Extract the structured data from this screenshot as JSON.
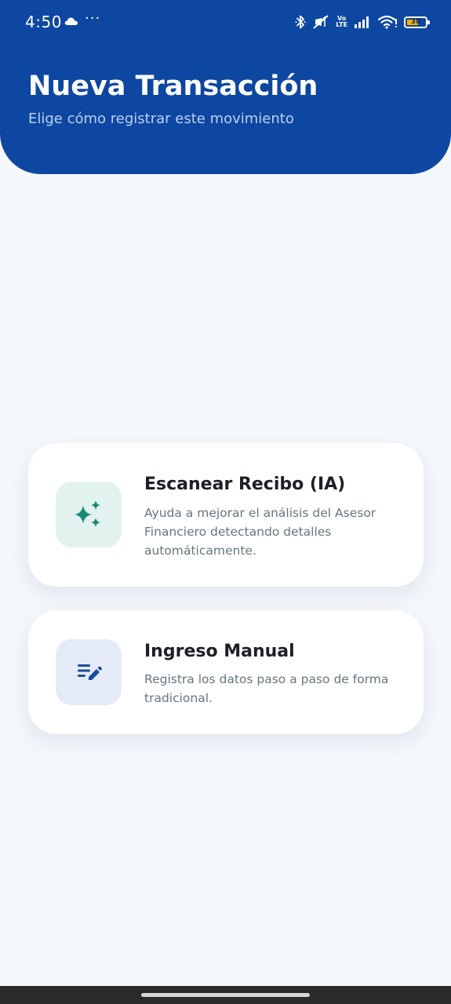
{
  "status_bar": {
    "time": "4:50",
    "more_indicator": "···",
    "network_type_top": "Vo",
    "network_type_bottom": "LTE",
    "battery_level": "38",
    "icons": [
      "cloud-icon",
      "bluetooth-icon",
      "mute-icon",
      "signal-icon",
      "wifi-icon",
      "battery-icon"
    ]
  },
  "header": {
    "title": "Nueva Transacción",
    "subtitle": "Elige cómo registrar este movimiento",
    "background_color": "#0d47a1"
  },
  "options": [
    {
      "title": "Escanear Recibo (IA)",
      "description": "Ayuda a mejorar el análisis del Asesor Financiero detectando detalles automáticamente.",
      "icon": "sparkles-icon",
      "icon_color": "#178a76",
      "icon_bg": "#e2f2ef"
    },
    {
      "title": "Ingreso Manual",
      "description": "Registra los datos paso a paso de forma tradicional.",
      "icon": "edit-list-icon",
      "icon_color": "#1d4c9a",
      "icon_bg": "#e4ebf6"
    }
  ]
}
